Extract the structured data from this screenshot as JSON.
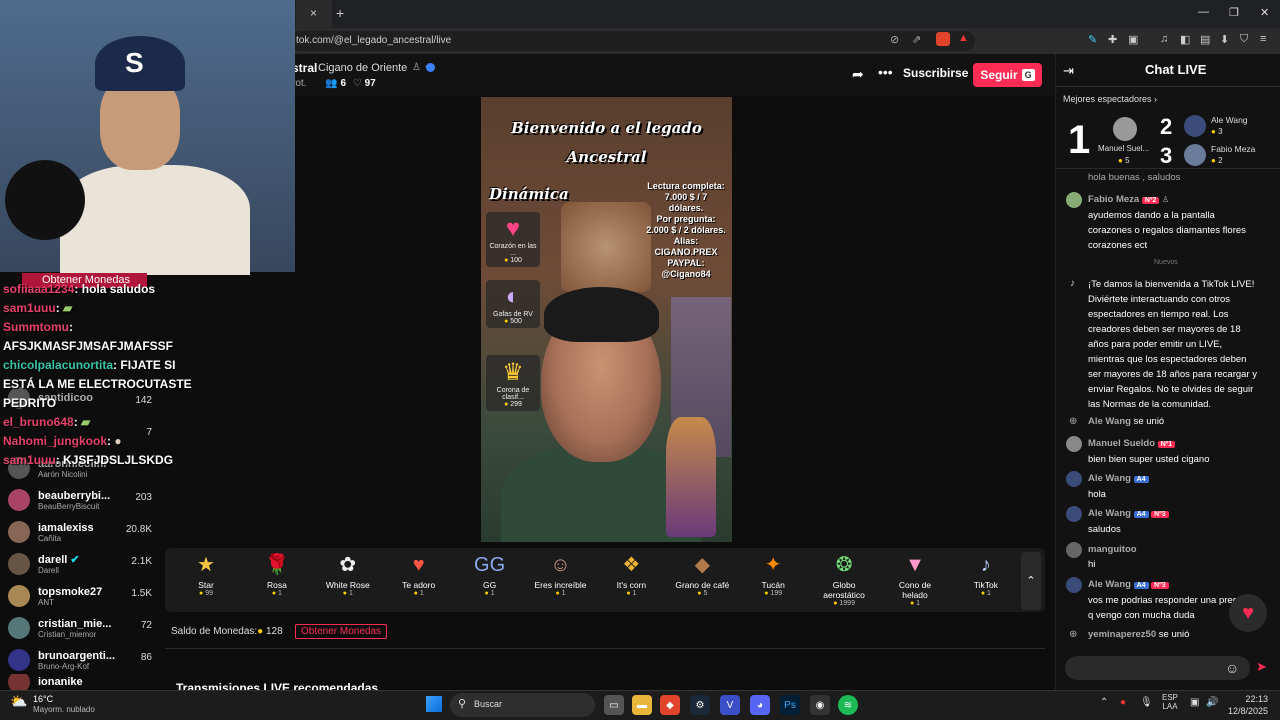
{
  "browser": {
    "url": "tok.com/@el_legado_ancestral/live",
    "tab_close": "×",
    "new_tab": "+"
  },
  "header": {
    "name_fragment": "stral",
    "subtitle": "Cigano de Oriente",
    "meta_prefix": "rot.",
    "viewers": "6",
    "likes": "97",
    "subscribe": "Suscribirse",
    "follow": "Seguir",
    "follow_key": "G"
  },
  "video": {
    "title_line1": "Bienvenido a el legado",
    "title_line2": "Ancestral",
    "dinamica": "Dinámica",
    "info": [
      "Lectura completa:",
      "7.000 $ / 7",
      "dólares.",
      "Por pregunta:",
      "2.000 $ / 2 dólares.",
      "Alias:",
      "CIGANO.PREX",
      "PAYPAL:",
      "@Cigano84"
    ],
    "goals": [
      {
        "label": "Corazón en las ...",
        "coins": "100",
        "icon": "heart"
      },
      {
        "label": "Gafas de RV",
        "coins": "500",
        "icon": "vr"
      },
      {
        "label": "Corona de clasif...",
        "coins": "299",
        "icon": "crown"
      }
    ]
  },
  "overlay": {
    "obtener": "Obtener Monedas",
    "lines": [
      {
        "name": "sofiiaaa1234",
        "text": "hola saludos",
        "style": "a"
      },
      {
        "name": "sam1uuu",
        "text": "",
        "style": "a"
      },
      {
        "name": "Summtomu",
        "text": "",
        "style": "a"
      },
      {
        "name": "",
        "text": "AFSJKMASFJMSAFJMAFSSF",
        "style": "a"
      },
      {
        "name": "chicolpalacunortita",
        "text": "FIJATE SI",
        "style": "b"
      },
      {
        "name": "",
        "text": "ESTÁ LA ME ELECTROCUTASTE",
        "style": "a"
      },
      {
        "name": "",
        "text": "PEDRITO",
        "style": "a"
      },
      {
        "name": "el_bruno648",
        "text": "",
        "style": "a"
      },
      {
        "name": "Nahomi_jungkook",
        "text": "",
        "style": "a"
      },
      {
        "name": "sam1uuu",
        "text": "KJSFJDSLJLSKDG",
        "style": "a"
      }
    ]
  },
  "viewers_list": [
    {
      "name": "santidicoo",
      "sub": "",
      "count": "142"
    },
    {
      "name": "",
      "sub": "",
      "count": "7"
    },
    {
      "name": "aaronnicolini",
      "sub": "Aarón Nicolini",
      "count": ""
    },
    {
      "name": "beauberrybi...",
      "sub": "BeauBerryBiscuit",
      "count": "203"
    },
    {
      "name": "iamalexiss",
      "sub": "Cañita",
      "count": "20.8K"
    },
    {
      "name": "darell",
      "sub": "Darell",
      "count": "2.1K"
    },
    {
      "name": "topsmoke27",
      "sub": "ANT",
      "count": "1.5K"
    },
    {
      "name": "cristian_mie...",
      "sub": "Cristian_miemor",
      "count": "72"
    },
    {
      "name": "brunoargenti...",
      "sub": "Bruno-Arg-Kof",
      "count": "86"
    },
    {
      "name": "ionanike",
      "sub": "",
      "count": ""
    }
  ],
  "gifts": [
    {
      "name": "Star",
      "price": "99",
      "icon": "★",
      "color": "#f5c542"
    },
    {
      "name": "Rosa",
      "price": "1",
      "icon": "🌹",
      "color": "#e33"
    },
    {
      "name": "White Rose",
      "price": "1",
      "icon": "✿",
      "color": "#eee"
    },
    {
      "name": "Te adoro",
      "price": "1",
      "icon": "♥",
      "color": "#f54"
    },
    {
      "name": "GG",
      "price": "1",
      "icon": "GG",
      "color": "#8ae"
    },
    {
      "name": "Eres increíble",
      "price": "1",
      "icon": "☺",
      "color": "#c98"
    },
    {
      "name": "It's corn",
      "price": "1",
      "icon": "❖",
      "color": "#f0b030"
    },
    {
      "name": "Grano de café",
      "price": "5",
      "icon": "◆",
      "color": "#b07a4a"
    },
    {
      "name": "Tucán",
      "price": "199",
      "icon": "✦",
      "color": "#f80"
    },
    {
      "name": "Globo aerostático",
      "price": "1999",
      "icon": "❂",
      "color": "#7d7"
    },
    {
      "name": "Cono de helado",
      "price": "1",
      "icon": "▼",
      "color": "#f9c"
    },
    {
      "name": "TikTok",
      "price": "1",
      "icon": "♪",
      "color": "#bcf"
    }
  ],
  "wallet": {
    "label": "Saldo de Monedas:",
    "amount": "128",
    "get_coins": "Obtener Monedas"
  },
  "recommended": "Transmisiones LIVE recomendadas",
  "chat": {
    "title": "Chat LIVE",
    "top_label": "Mejores espectadores",
    "top": [
      {
        "rank": "1",
        "name": "Manuel Suel...",
        "coins": "5"
      },
      {
        "rank": "2",
        "name": "Ale Wang",
        "coins": "3"
      },
      {
        "rank": "3",
        "name": "Fabio Meza",
        "coins": "2"
      }
    ],
    "cut_line": "hola buenas , saludos",
    "nuevos": "Nuevos",
    "messages": [
      {
        "name": "Fabio Meza",
        "badge": "Nº2",
        "text": "ayudemos dando a la pantalla corazones o regalos diamantes flores corazones ect"
      },
      {
        "name": "",
        "badge": "",
        "text": "¡Te damos la bienvenida a TikTok LIVE! Diviértete interactuando con otros espectadores en tiempo real. Los creadores deben ser mayores de 18 años para poder emitir un LIVE, mientras que los espectadores deben ser mayores de 18 años para recargar y enviar Regalos. No te olvides de seguir las Normas de la comunidad."
      },
      {
        "name": "Ale Wang",
        "badge": "",
        "text": "se unió"
      },
      {
        "name": "Manuel Sueldo",
        "badge": "Nº1",
        "text": "bien bien super usted cigano"
      },
      {
        "name": "Ale Wang",
        "badge": "A4",
        "text": "hola"
      },
      {
        "name": "Ale Wang",
        "badge": "A4",
        "badge2": "Nº3",
        "text": "saludos"
      },
      {
        "name": "manguitoo",
        "badge": "",
        "text": "hi"
      },
      {
        "name": "Ale Wang",
        "badge": "A4",
        "badge2": "Nº3",
        "text": "vos me podrias responder una pregunta q vengo con mucha duda"
      },
      {
        "name": "yeminaperez50",
        "badge": "",
        "text": "se unió"
      }
    ]
  },
  "taskbar": {
    "weather_temp": "16°C",
    "weather_desc": "Mayorm. nublado",
    "search": "Buscar",
    "lang1": "ESP",
    "lang2": "LAA",
    "time": "22:13",
    "date": "12/8/2025"
  }
}
